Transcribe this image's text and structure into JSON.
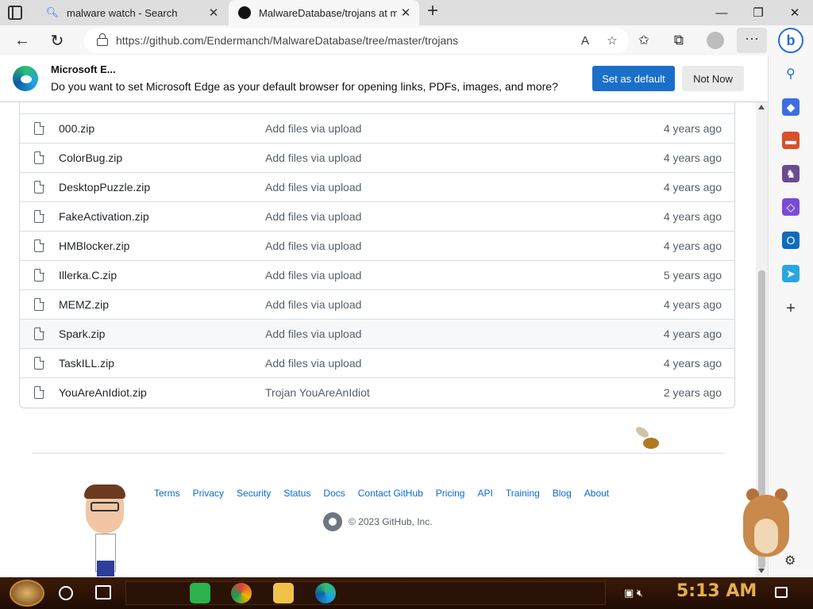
{
  "browser": {
    "tabs": [
      {
        "title": "malware watch - Search",
        "icon": "search-icon",
        "active": false
      },
      {
        "title": "MalwareDatabase/trojans at mas",
        "icon": "github-icon",
        "active": true
      }
    ],
    "url": "https://github.com/Endermanch/MalwareDatabase/tree/master/trojans"
  },
  "infobar": {
    "title": "Microsoft E...",
    "message": "Do you want to set Microsoft Edge as your default browser for opening links, PDFs, images, and more?",
    "primary_button": "Set as default",
    "secondary_button": "Not Now"
  },
  "files": [
    {
      "name": "000.zip",
      "message": "Add files via upload",
      "date": "4 years ago"
    },
    {
      "name": "ColorBug.zip",
      "message": "Add files via upload",
      "date": "4 years ago"
    },
    {
      "name": "DesktopPuzzle.zip",
      "message": "Add files via upload",
      "date": "4 years ago"
    },
    {
      "name": "FakeActivation.zip",
      "message": "Add files via upload",
      "date": "4 years ago"
    },
    {
      "name": "HMBlocker.zip",
      "message": "Add files via upload",
      "date": "4 years ago"
    },
    {
      "name": "Illerka.C.zip",
      "message": "Add files via upload",
      "date": "5 years ago"
    },
    {
      "name": "MEMZ.zip",
      "message": "Add files via upload",
      "date": "4 years ago"
    },
    {
      "name": "Spark.zip",
      "message": "Add files via upload",
      "date": "4 years ago"
    },
    {
      "name": "TaskILL.zip",
      "message": "Add files via upload",
      "date": "4 years ago"
    },
    {
      "name": "YouAreAnIdiot.zip",
      "message": "Trojan YouAreAnIdiot",
      "date": "2 years ago"
    }
  ],
  "footer": {
    "links": [
      "Terms",
      "Privacy",
      "Security",
      "Status",
      "Docs",
      "Contact GitHub",
      "Pricing",
      "API",
      "Training",
      "Blog",
      "About"
    ],
    "copyright": "© 2023 GitHub, Inc."
  },
  "taskbar": {
    "clock": "5:13 AM"
  },
  "colors": {
    "accent": "#1a6fc9",
    "link": "#0969da",
    "taskbar": "#2a1206",
    "clock": "#e6b04a"
  }
}
